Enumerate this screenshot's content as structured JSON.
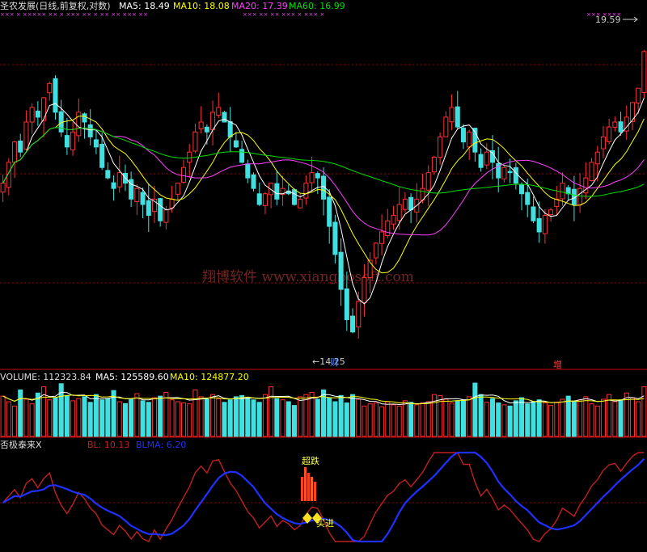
{
  "header": {
    "title": "圣农发展(日线,前复权,对数)",
    "ma5": "MA5: 18.49",
    "ma10": "MA10: 18.08",
    "ma20": "MA20: 17.39",
    "ma60": "MA60: 16.99"
  },
  "volume_header": {
    "title": "VOLUME: 112323.84",
    "ma5": "MA5: 125589.60",
    "ma10": "MA10: 124877.20"
  },
  "indicator_header": {
    "title": "否极泰来X",
    "bl": "BL: 10.13",
    "blma": "BLMA: 6.20"
  },
  "annotations": {
    "high_label": "19.59",
    "low_label": "←14.25",
    "event_cai": "财",
    "event_zeng": "增",
    "signal_top": "超跌",
    "signal_bottom": "买进"
  },
  "watermark": "翔博软件 www.xiangbosoft.com",
  "colors": {
    "up": "#ff3030",
    "down": "#40e0e0",
    "ma5": "#ffffff",
    "ma10": "#ffff00",
    "ma20": "#ff40ff",
    "ma60": "#00e000",
    "bl": "#c02020",
    "blma": "#2030ff",
    "grid": "#a00000"
  },
  "chart_data": [
    {
      "type": "candlestick",
      "title": "圣农发展(日线,前复权,对数)",
      "scale": "log",
      "ylim": [
        13.8,
        20.2
      ],
      "annotations": {
        "max": 19.59,
        "min": 14.25
      },
      "series": [
        {
          "name": "MA5",
          "last": 18.49
        },
        {
          "name": "MA10",
          "last": 18.08
        },
        {
          "name": "MA20",
          "last": 17.39
        },
        {
          "name": "MA60",
          "last": 16.99
        }
      ],
      "close": [
        16.9,
        17.3,
        17.7,
        17.5,
        18.1,
        18.4,
        18.2,
        18.6,
        18.9,
        18.3,
        17.9,
        17.6,
        17.9,
        18.3,
        18.1,
        17.8,
        17.6,
        17.2,
        17.0,
        16.8,
        17.1,
        16.9,
        16.6,
        16.8,
        16.5,
        16.3,
        16.6,
        16.2,
        16.4,
        16.6,
        16.9,
        17.2,
        17.5,
        17.9,
        18.1,
        17.9,
        18.3,
        18.4,
        18.1,
        17.8,
        17.6,
        17.3,
        17.0,
        16.8,
        16.5,
        16.7,
        16.9,
        16.6,
        16.8,
        16.7,
        16.5,
        16.6,
        16.9,
        17.1,
        17.0,
        16.6,
        16.1,
        15.6,
        15.0,
        14.5,
        14.3,
        14.8,
        15.2,
        15.5,
        15.8,
        16.0,
        16.2,
        16.3,
        16.5,
        16.6,
        16.4,
        16.6,
        16.8,
        17.1,
        17.4,
        17.8,
        18.2,
        18.4,
        18.0,
        17.7,
        17.9,
        17.5,
        17.2,
        17.5,
        17.3,
        17.0,
        17.2,
        17.1,
        16.9,
        16.7,
        16.5,
        16.2,
        16.0,
        16.3,
        16.4,
        16.6,
        16.9,
        16.7,
        16.5,
        16.8,
        17.0,
        17.3,
        17.5,
        17.8,
        18.0,
        18.1,
        17.9,
        18.2,
        18.5,
        18.8,
        19.59
      ]
    },
    {
      "type": "bar",
      "title": "VOLUME",
      "series": [
        {
          "name": "VOLUME",
          "last": 112323.84
        },
        {
          "name": "MA5",
          "last": 125589.6
        },
        {
          "name": "MA10",
          "last": 124877.2
        }
      ],
      "values": [
        130,
        112,
        98,
        150,
        120,
        105,
        140,
        160,
        118,
        125,
        170,
        132,
        115,
        122,
        128,
        110,
        135,
        118,
        122,
        148,
        112,
        106,
        120,
        138,
        115,
        110,
        125,
        130,
        142,
        118,
        112,
        108,
        105,
        150,
        128,
        120,
        135,
        122,
        110,
        118,
        128,
        132,
        126,
        118,
        110,
        135,
        160,
        122,
        118,
        112,
        100,
        128,
        135,
        142,
        120,
        150,
        125,
        112,
        132,
        108,
        135,
        120,
        98,
        105,
        108,
        95,
        112,
        102,
        98,
        115,
        110,
        102,
        108,
        112,
        135,
        132,
        120,
        108,
        115,
        118,
        128,
        172,
        135,
        110,
        122,
        108,
        102,
        98,
        115,
        125,
        105,
        112,
        118,
        108,
        100,
        110,
        120,
        130,
        112,
        118,
        128,
        105,
        98,
        120,
        135,
        112,
        118,
        140,
        125,
        112,
        160
      ]
    },
    {
      "type": "line",
      "title": "否极泰来X",
      "series": [
        {
          "name": "BL",
          "last": 10.13
        },
        {
          "name": "BLMA",
          "last": 6.2
        }
      ],
      "signals": [
        "超跌",
        "买进"
      ]
    }
  ]
}
